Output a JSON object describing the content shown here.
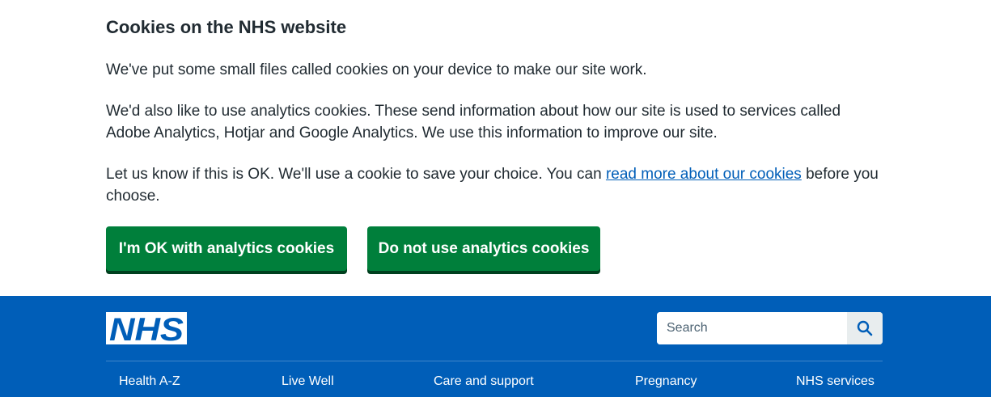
{
  "cookie_banner": {
    "heading": "Cookies on the NHS website",
    "paragraph_1": "We've put some small files called cookies on your device to make our site work.",
    "paragraph_2": "We'd also like to use analytics cookies. These send information about how our site is used to services called Adobe Analytics, Hotjar and Google Analytics. We use this information to improve our site.",
    "paragraph_3_before_link": "Let us know if this is OK. We'll use a cookie to save your choice. You can ",
    "paragraph_3_link": "read more about our cookies",
    "paragraph_3_after_link": " before you choose.",
    "accept_button": "I'm OK with analytics cookies",
    "reject_button": "Do not use analytics cookies"
  },
  "header": {
    "logo_text": "NHS",
    "search": {
      "placeholder": "Search",
      "value": "",
      "icon": "search-icon"
    },
    "nav": [
      {
        "label": "Health A-Z"
      },
      {
        "label": "Live Well"
      },
      {
        "label": "Care and support"
      },
      {
        "label": "Pregnancy"
      },
      {
        "label": "NHS services"
      }
    ]
  },
  "colors": {
    "nhs_blue": "#005eb8",
    "button_green": "#007f3b",
    "button_shadow": "#00401e",
    "text": "#212b32",
    "link": "#005eb8"
  }
}
